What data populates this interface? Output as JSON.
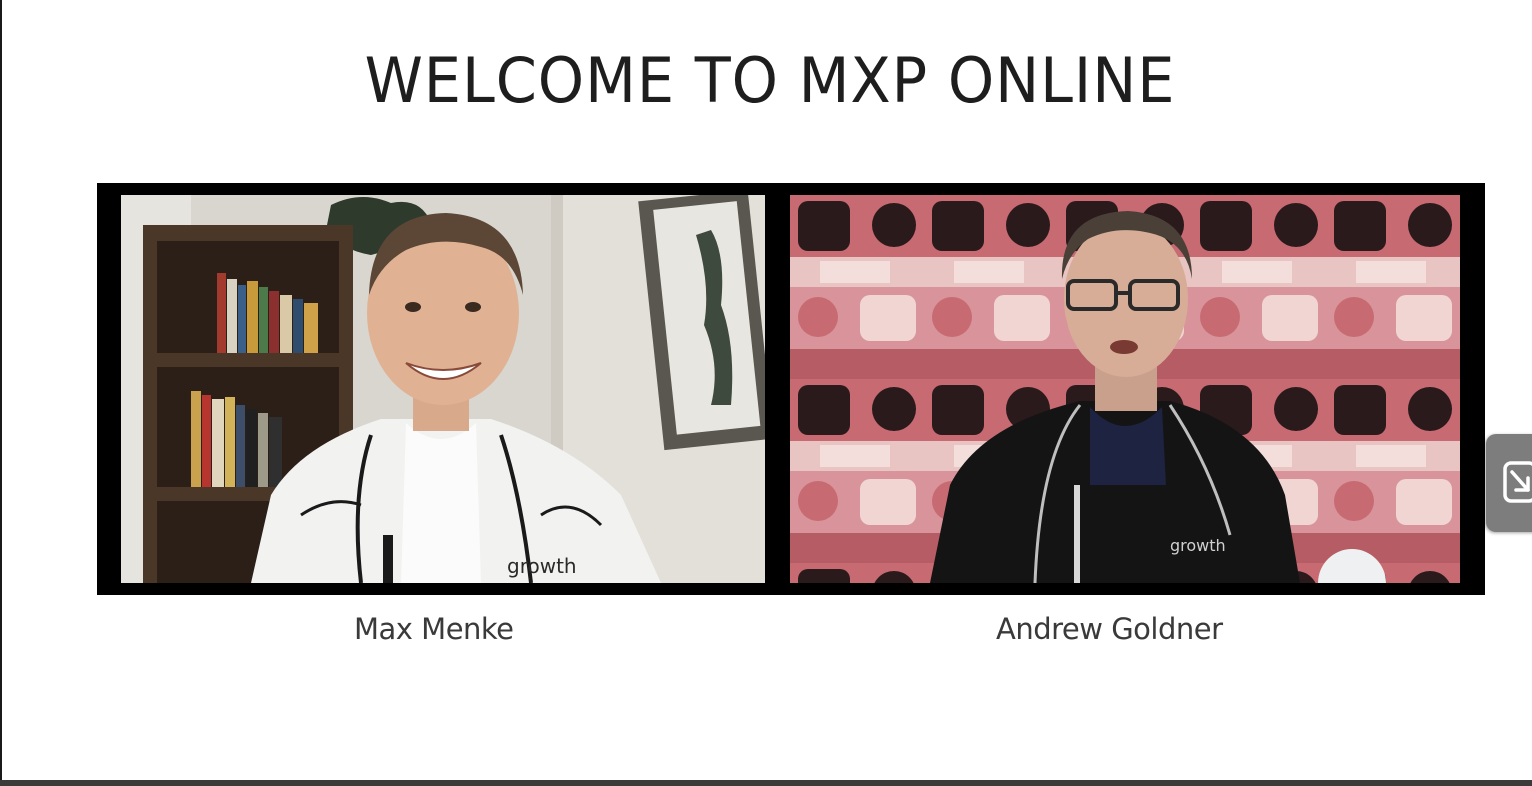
{
  "slide": {
    "title": "WELCOME TO MXP ONLINE"
  },
  "participants": [
    {
      "name": "Max Menke",
      "shirt_logo": "growth"
    },
    {
      "name": "Andrew Goldner",
      "shirt_logo": "growth"
    }
  ],
  "controls": {
    "pip_toggle_icon": "minimize-to-corner-icon"
  },
  "colors": {
    "background": "#ffffff",
    "video_frame": "#000000",
    "title_text": "#1e1e1e",
    "caption_text": "#3a3a3a",
    "right_wall_red": "#c86a72",
    "right_wall_pink": "#e8c4c2"
  }
}
